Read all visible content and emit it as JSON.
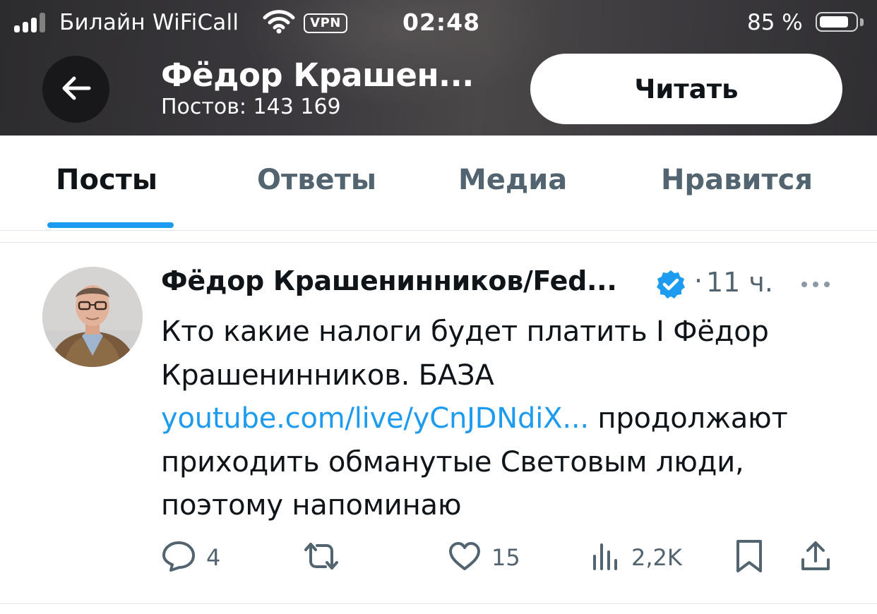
{
  "status": {
    "carrier": "Билайн WiFiCall",
    "vpn": "VPN",
    "time": "02:48",
    "battery": "85 %",
    "battery_level": 0.85,
    "signal_bars": 3
  },
  "header": {
    "name": "Фёдор Крашен...",
    "posts": "Постов: 143 169",
    "follow_label": "Читать"
  },
  "tabs": [
    {
      "label": "Посты",
      "active": true
    },
    {
      "label": "Ответы",
      "active": false
    },
    {
      "label": "Медиа",
      "active": false
    },
    {
      "label": "Нравится",
      "active": false
    }
  ],
  "tweet": {
    "author": "Фёдор Крашенинников/Fed...",
    "dot": "·",
    "time": "11 ч.",
    "text_before": "Кто какие налоги будет платить I Фёдор Крашенинников. БАЗА ",
    "link": "youtube.com/live/yCnJDNdiX...",
    "text_after": " продолжают приходить обманутые Световым люди, поэтому напоминаю",
    "replies": "4",
    "retweets": "",
    "likes": "15",
    "views": "2,2K"
  },
  "colors": {
    "accent": "#1d9bf0",
    "muted": "#536471",
    "text": "#0f1419"
  },
  "icons": {
    "back": "arrow-left-icon",
    "verified": "verified-badge-icon",
    "more": "more-dots-icon",
    "reply": "comment-icon",
    "retweet": "retweet-icon",
    "like": "heart-icon",
    "views": "views-bar-chart-icon",
    "bookmark": "bookmark-icon",
    "share": "share-icon"
  }
}
